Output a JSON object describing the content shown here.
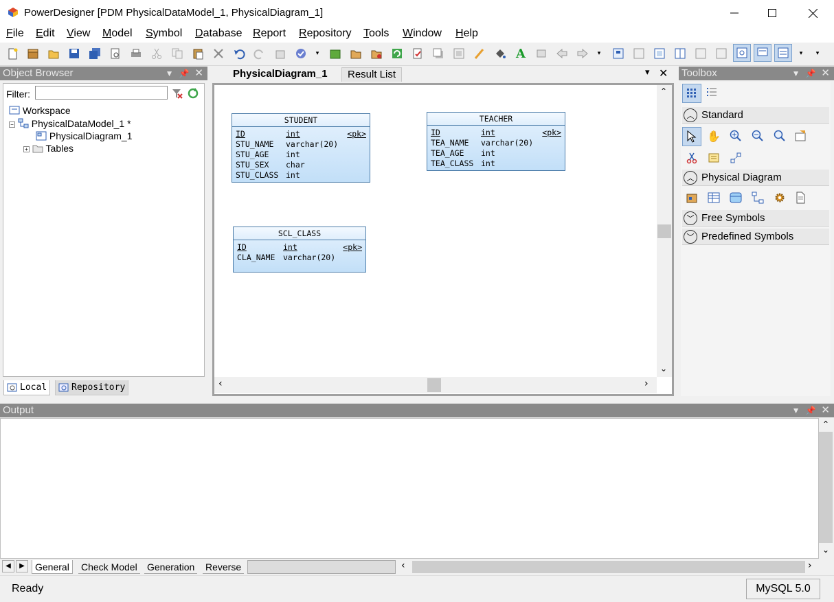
{
  "window": {
    "title": "PowerDesigner [PDM PhysicalDataModel_1, PhysicalDiagram_1]"
  },
  "menu": [
    {
      "hot": "F",
      "rest": "ile"
    },
    {
      "hot": "E",
      "rest": "dit"
    },
    {
      "hot": "V",
      "rest": "iew"
    },
    {
      "hot": "M",
      "rest": "odel"
    },
    {
      "hot": "S",
      "rest": "ymbol"
    },
    {
      "hot": "D",
      "rest": "atabase"
    },
    {
      "hot": "R",
      "rest": "eport"
    },
    {
      "hot": "R",
      "rest": "epository"
    },
    {
      "hot": "T",
      "rest": "ools"
    },
    {
      "hot": "W",
      "rest": "indow"
    },
    {
      "hot": "H",
      "rest": "elp"
    }
  ],
  "object_browser": {
    "title": "Object Browser",
    "filter_label": "Filter:",
    "filter_value": "",
    "tree": {
      "workspace": "Workspace",
      "model": "PhysicalDataModel_1 *",
      "diagram": "PhysicalDiagram_1",
      "tables": "Tables"
    },
    "tabs": {
      "local": "Local",
      "repository": "Repository"
    }
  },
  "document": {
    "tabs": {
      "active": "PhysicalDiagram_1",
      "other": "Result List"
    },
    "entities": {
      "student": {
        "name": "STUDENT",
        "columns": [
          {
            "name": "ID",
            "type": "int",
            "key": "<pk>"
          },
          {
            "name": "STU_NAME",
            "type": "varchar(20)",
            "key": ""
          },
          {
            "name": "STU_AGE",
            "type": "int",
            "key": ""
          },
          {
            "name": "STU_SEX",
            "type": "char",
            "key": ""
          },
          {
            "name": "STU_CLASS",
            "type": "int",
            "key": ""
          }
        ]
      },
      "teacher": {
        "name": "TEACHER",
        "columns": [
          {
            "name": "ID",
            "type": "int",
            "key": "<pk>"
          },
          {
            "name": "TEA_NAME",
            "type": "varchar(20)",
            "key": ""
          },
          {
            "name": "TEA_AGE",
            "type": "int",
            "key": ""
          },
          {
            "name": "TEA_CLASS",
            "type": "int",
            "key": ""
          }
        ]
      },
      "scl_class": {
        "name": "SCL_CLASS",
        "columns": [
          {
            "name": "ID",
            "type": "int",
            "key": "<pk>"
          },
          {
            "name": "CLA_NAME",
            "type": "varchar(20)",
            "key": ""
          }
        ]
      }
    }
  },
  "toolbox": {
    "title": "Toolbox",
    "sections": {
      "standard": "Standard",
      "physical": "Physical Diagram",
      "free": "Free Symbols",
      "predefined": "Predefined Symbols"
    }
  },
  "output": {
    "title": "Output",
    "tabs": {
      "general": "General",
      "check": "Check Model",
      "generation": "Generation",
      "reverse": "Reverse"
    }
  },
  "status": {
    "text": "Ready",
    "dbms": "MySQL 5.0"
  },
  "colors": {
    "panel_header": "#898989",
    "entity_border": "#4a7ba8",
    "entity_fill": "#c2dff8"
  }
}
